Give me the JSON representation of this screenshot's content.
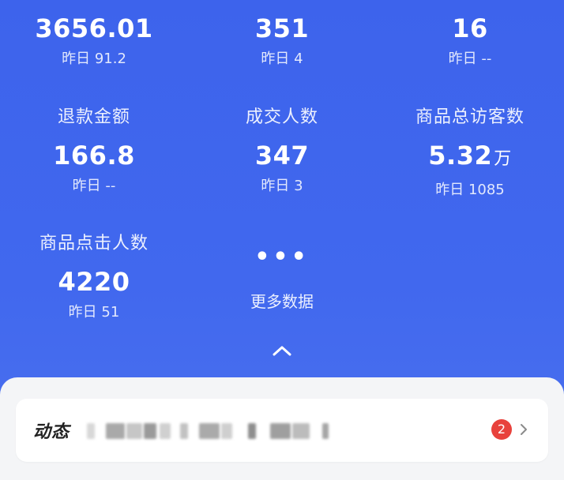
{
  "metrics_row1": [
    {
      "value": "3656.01",
      "sub": "昨日 91.2"
    },
    {
      "value": "351",
      "sub": "昨日 4"
    },
    {
      "value": "16",
      "sub": "昨日 --"
    }
  ],
  "metrics_row2": [
    {
      "label": "退款金额",
      "value": "166.8",
      "unit": "",
      "sub": "昨日 --"
    },
    {
      "label": "成交人数",
      "value": "347",
      "unit": "",
      "sub": "昨日 3"
    },
    {
      "label": "商品总访客数",
      "value": "5.32",
      "unit": "万",
      "sub": "昨日 1085"
    }
  ],
  "metrics_row3": [
    {
      "label": "商品点击人数",
      "value": "4220",
      "sub": "昨日 51"
    }
  ],
  "more_data": {
    "dots": "•••",
    "label": "更多数据"
  },
  "feed": {
    "title": "动态",
    "badge_count": "2"
  },
  "colors": {
    "background": "#3f63ea",
    "badge": "#e8423c",
    "panel": "#f4f5f7"
  },
  "icons": {
    "collapse": "chevron-up-icon",
    "more": "ellipsis-icon",
    "chevron": "chevron-right-icon"
  }
}
